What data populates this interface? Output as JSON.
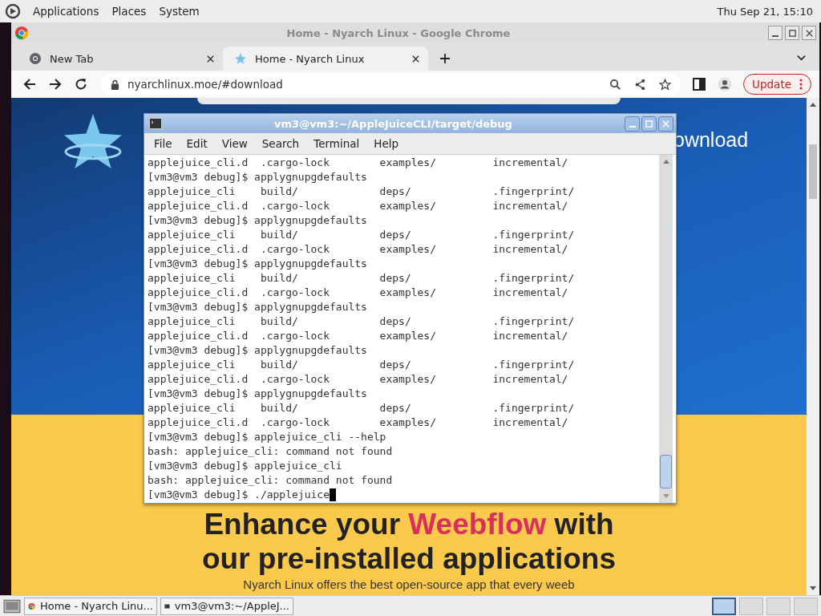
{
  "top_panel": {
    "menus": [
      "Applications",
      "Places",
      "System"
    ],
    "clock": "Thu Sep 21, 15:10"
  },
  "browser": {
    "title": "Home - Nyarch Linux - Google Chrome",
    "tabs": [
      {
        "label": "New Tab",
        "selected": false,
        "kind": "chrome"
      },
      {
        "label": "Home - Nyarch Linux",
        "selected": true,
        "kind": "site"
      }
    ],
    "address": "nyarchlinux.moe/#download",
    "update_button": "Update",
    "page": {
      "download_heading": "ownload",
      "headline_before": "Enhance your ",
      "headline_accent": "Weebflow",
      "headline_after": " with",
      "headline_line2": "our pre-installed applications",
      "subtext": "Nyarch Linux offers the best open-source app that every weeb"
    }
  },
  "terminal": {
    "title": "vm3@vm3:~/AppleJuiceCLI/target/debug",
    "menu": [
      "File",
      "Edit",
      "View",
      "Search",
      "Terminal",
      "Help"
    ],
    "lines": [
      "applejuice_cli.d  .cargo-lock        examples/         incremental/",
      "[vm3@vm3 debug]$ applygnupgdefaults",
      "applejuice_cli    build/             deps/             .fingerprint/",
      "applejuice_cli.d  .cargo-lock        examples/         incremental/",
      "[vm3@vm3 debug]$ applygnupgdefaults",
      "applejuice_cli    build/             deps/             .fingerprint/",
      "applejuice_cli.d  .cargo-lock        examples/         incremental/",
      "[vm3@vm3 debug]$ applygnupgdefaults",
      "applejuice_cli    build/             deps/             .fingerprint/",
      "applejuice_cli.d  .cargo-lock        examples/         incremental/",
      "[vm3@vm3 debug]$ applygnupgdefaults",
      "applejuice_cli    build/             deps/             .fingerprint/",
      "applejuice_cli.d  .cargo-lock        examples/         incremental/",
      "[vm3@vm3 debug]$ applygnupgdefaults",
      "applejuice_cli    build/             deps/             .fingerprint/",
      "applejuice_cli.d  .cargo-lock        examples/         incremental/",
      "[vm3@vm3 debug]$ applygnupgdefaults",
      "applejuice_cli    build/             deps/             .fingerprint/",
      "applejuice_cli.d  .cargo-lock        examples/         incremental/",
      "[vm3@vm3 debug]$ applejuice_cli --help",
      "bash: applejuice_cli: command not found",
      "[vm3@vm3 debug]$ applejuice_cli",
      "bash: applejuice_cli: command not found",
      "[vm3@vm3 debug]$ ./applejuice"
    ]
  },
  "taskbar": {
    "tasks": [
      {
        "label": "Home - Nyarch Linu...",
        "kind": "chrome"
      },
      {
        "label": "vm3@vm3:~/AppleJ...",
        "kind": "terminal"
      }
    ],
    "workspaces": [
      {
        "selected": true
      },
      {
        "selected": false
      },
      {
        "selected": false
      },
      {
        "selected": false
      }
    ]
  }
}
